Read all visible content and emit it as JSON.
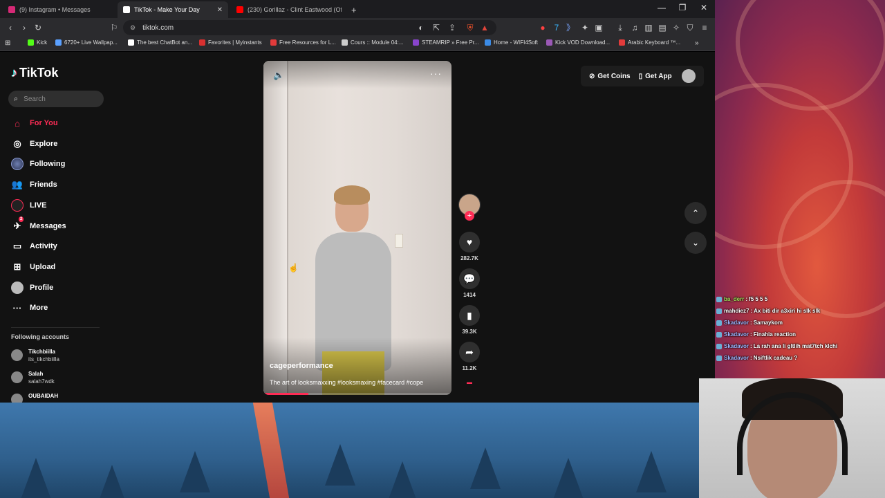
{
  "tabs": [
    {
      "title": "(9) Instagram • Messages",
      "color": "#d62976",
      "active": false
    },
    {
      "title": "TikTok - Make Your Day",
      "color": "#ffffff",
      "active": true
    },
    {
      "title": "(230) Gorillaz - Clint Eastwood (Offic",
      "color": "#ff0000",
      "active": false
    }
  ],
  "new_tab_label": "+",
  "window_controls": {
    "minimize": "—",
    "maximize": "❐",
    "close": "✕"
  },
  "url": "tiktok.com",
  "bookmarks": [
    {
      "label": "Kick",
      "color": "#53fc18"
    },
    {
      "label": "6720+ Live Wallpap...",
      "color": "#5aa0ff"
    },
    {
      "label": "The best ChatBot an...",
      "color": "#ffffff"
    },
    {
      "label": "Favorites | Myinstants",
      "color": "#d93030"
    },
    {
      "label": "Free Resources for L...",
      "color": "#e23b3b"
    },
    {
      "label": "Cours :: Module 04:...",
      "color": "#cccccc"
    },
    {
      "label": "STEAMRIP » Free Pr...",
      "color": "#8844cc"
    },
    {
      "label": "Home - WIFI4Soft",
      "color": "#3b8be6"
    },
    {
      "label": "Kick VOD Download...",
      "color": "#9b59b6"
    },
    {
      "label": "Arabic Keyboard ™...",
      "color": "#e23b3b"
    }
  ],
  "tiktok": {
    "brand": "TikTok",
    "search_placeholder": "Search",
    "nav": [
      {
        "label": "For You",
        "icon": "home-icon",
        "glyph": "⌂",
        "active": true
      },
      {
        "label": "Explore",
        "icon": "compass-icon",
        "glyph": "◎",
        "active": false
      },
      {
        "label": "Following",
        "icon": "following-avatar-icon",
        "glyph": "",
        "active": false
      },
      {
        "label": "Friends",
        "icon": "friends-icon",
        "glyph": "👥",
        "active": false
      },
      {
        "label": "LIVE",
        "icon": "live-icon",
        "glyph": "",
        "active": false
      },
      {
        "label": "Messages",
        "icon": "messages-icon",
        "glyph": "✈",
        "active": false,
        "badge": "2"
      },
      {
        "label": "Activity",
        "icon": "activity-icon",
        "glyph": "▭",
        "active": false
      },
      {
        "label": "Upload",
        "icon": "upload-icon",
        "glyph": "⊞",
        "active": false
      },
      {
        "label": "Profile",
        "icon": "profile-avatar-icon",
        "glyph": "",
        "active": false
      },
      {
        "label": "More",
        "icon": "more-icon",
        "glyph": "···",
        "active": false
      }
    ],
    "following_accounts_title": "Following accounts",
    "following_accounts": [
      {
        "name": "Tikchbiilla",
        "handle": "its_tikchbiilla"
      },
      {
        "name": "Salah",
        "handle": "salah7wdk"
      },
      {
        "name": "OUBAIDAH",
        "handle": ""
      }
    ],
    "video": {
      "author": "cageperformance",
      "caption": "The art of looksmaxxing #looksmaxing #facecard #cope",
      "progress": 0.24
    },
    "actions": {
      "likes": "282.7K",
      "comments": "1414",
      "saves": "39.3K",
      "shares": "11.2K"
    },
    "header": {
      "get_coins": "Get Coins",
      "get_app": "Get App"
    }
  },
  "chat": [
    {
      "user": "ba_derr",
      "msg": "f5 5 5 5",
      "color": "#a6e05a"
    },
    {
      "user": "mahdiez7",
      "msg": "Ax biti dir a3xiri hi slk slk",
      "color": "#ffffff"
    },
    {
      "user": "Skadavor",
      "msg": "Samaykom",
      "color": "#9fb6ff"
    },
    {
      "user": "Skadavor",
      "msg": "Finahia reaction",
      "color": "#9fb6ff"
    },
    {
      "user": "Skadavor",
      "msg": "La rah ana li gltlih mat7tch klchi",
      "color": "#9fb6ff"
    },
    {
      "user": "Skadavor",
      "msg": "Nsiftlik cadeau ?",
      "color": "#9fb6ff"
    }
  ]
}
